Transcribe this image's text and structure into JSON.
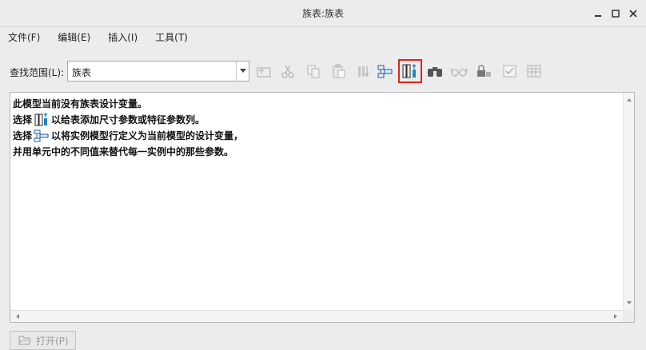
{
  "window": {
    "title": "族表:族表"
  },
  "menu": [
    {
      "label": "文件(F)"
    },
    {
      "label": "编辑(E)"
    },
    {
      "label": "插入(I)"
    },
    {
      "label": "工具(T)"
    }
  ],
  "toolbar": {
    "search_label": "查找范围(L):",
    "search_value": "族表"
  },
  "content": {
    "lines": [
      {
        "text": "此模型当前没有族表设计变量。"
      },
      {
        "pre": "选择",
        "post": "以给表添加尺寸参数或特征参数列。"
      },
      {
        "pre": "选择",
        "post": "以将实例模型行定义为当前模型的设计变量，"
      },
      {
        "text": "并用单元中的不同值来替代每一实例中的那些参数。"
      }
    ]
  },
  "footer": {
    "open_label": "打开(P)"
  },
  "colors": {
    "highlight": "#e2231a",
    "accent": "#1e88c8"
  }
}
